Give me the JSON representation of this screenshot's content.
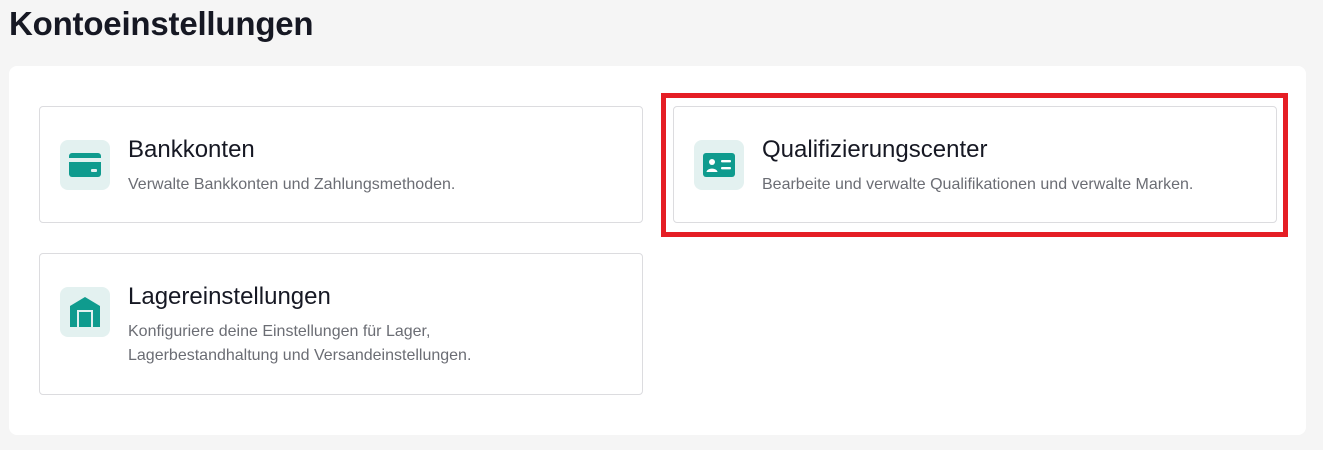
{
  "page": {
    "title": "Kontoeinstellungen"
  },
  "cards": [
    {
      "id": "bank",
      "title": "Bankkonten",
      "description_lines": [
        "Verwalte Bankkonten und Zahlungsmethoden."
      ],
      "icon": "credit-card-icon"
    },
    {
      "id": "qualification",
      "title": "Qualifizierungscenter",
      "description_lines": [
        "Bearbeite und verwalte Qualifikationen und verwalte Marken."
      ],
      "icon": "id-card-icon",
      "highlighted": true
    },
    {
      "id": "warehouse",
      "title": "Lagereinstellungen",
      "description_lines": [
        "Konfiguriere deine Einstellungen für Lager,",
        "Lagerbestandhaltung und Versandeinstellungen."
      ],
      "icon": "warehouse-icon"
    }
  ],
  "colors": {
    "accent": "#0f9b8e",
    "icon_tile_bg": "#e3f1f0",
    "highlight": "#e51e25",
    "page_bg": "#f5f5f5"
  }
}
